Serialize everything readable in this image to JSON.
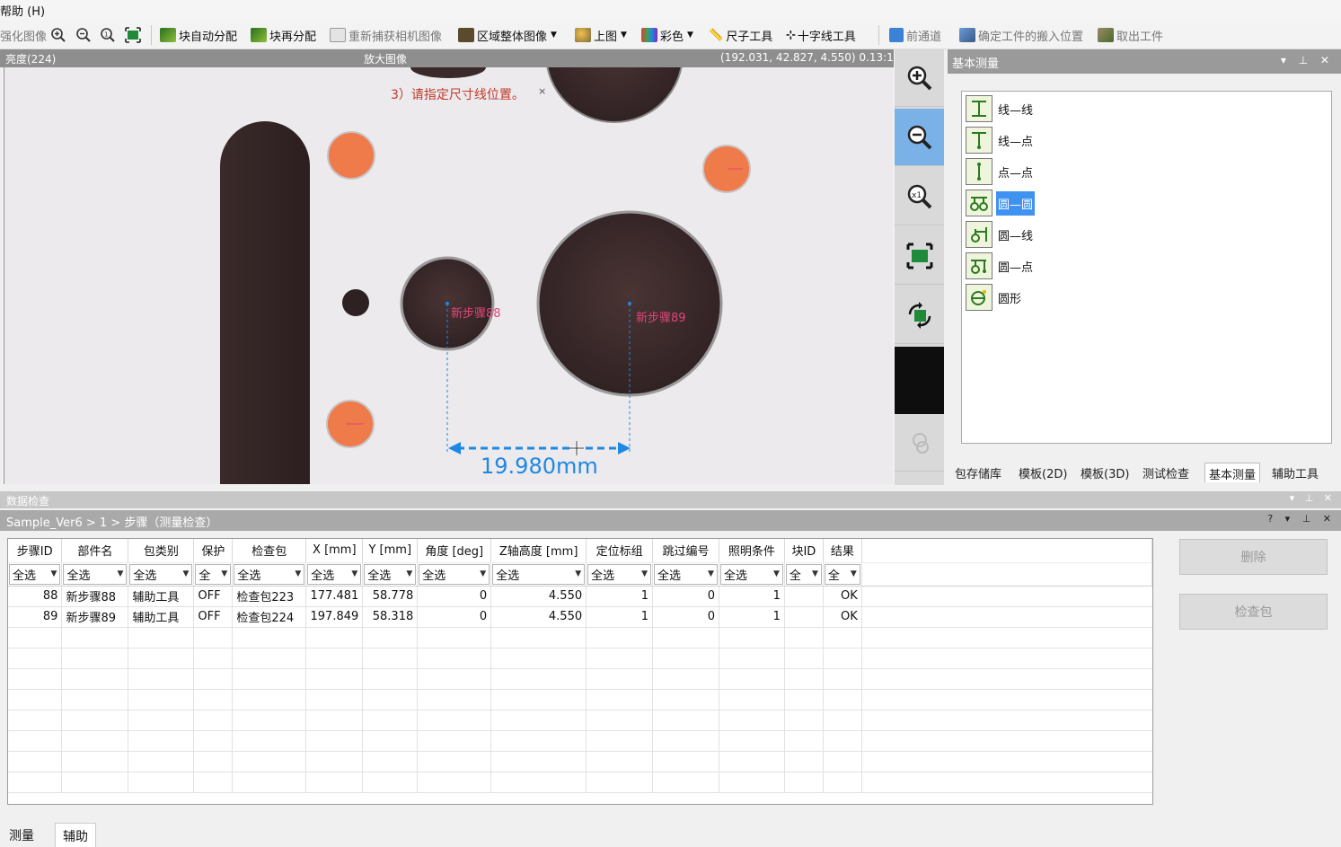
{
  "menu": {
    "help": "帮助 (H)"
  },
  "toolbar": {
    "items": [
      {
        "label": "强化图像",
        "dim": true
      },
      {
        "label": "块自动分配"
      },
      {
        "label": "块再分配"
      },
      {
        "label": "重新捕获相机图像",
        "dim": true
      },
      {
        "label": "区域整体图像"
      },
      {
        "label": "上图"
      },
      {
        "label": "彩色"
      },
      {
        "label": "尺子工具"
      },
      {
        "label": "十字线工具"
      },
      {
        "label": "前通道",
        "dim": true
      },
      {
        "label": "确定工件的搬入位置",
        "dim": true
      },
      {
        "label": "取出工件",
        "dim": true
      }
    ]
  },
  "image_view": {
    "brightness": "亮度(224)",
    "title": "放大图像",
    "coords": "(192.031, 42.827, 4.550) 0.13:1",
    "instruction": "3）请指定尺寸线位置。",
    "close_mark": "×",
    "step88_label": "新步骤88",
    "step89_label": "新步骤89",
    "dimension": "19.980mm"
  },
  "zoom": {
    "buttons": [
      "zoom-in",
      "zoom-out",
      "zoom-1x",
      "fit",
      "rotate"
    ]
  },
  "right_panel": {
    "title": "基本测量",
    "items": [
      "线—线",
      "线—点",
      "点—点",
      "圆—圆",
      "圆—线",
      "圆—点",
      "圆形"
    ],
    "selected_index": 3,
    "tabs": [
      "包存储库",
      "模板(2D)",
      "模板(3D)",
      "测试检查",
      "基本测量",
      "辅助工具"
    ],
    "active_tab": 4
  },
  "data_check": {
    "title": "数据检查",
    "breadcrumb": "Sample_Ver6 > 1 > 步骤（测量检查）",
    "help": "?",
    "columns": [
      "步骤ID",
      "部件名",
      "包类别",
      "保护",
      "检查包",
      "X [mm]",
      "Y [mm]",
      "角度 [deg]",
      "Z轴高度 [mm]",
      "定位标组",
      "跳过编号",
      "照明条件",
      "块ID",
      "结果"
    ],
    "filters": [
      "全选",
      "全选",
      "全选",
      "全",
      "全选",
      "全选",
      "全选",
      "全选",
      "全选",
      "全选",
      "全选",
      "全选",
      "全",
      "全"
    ],
    "rows": [
      [
        "88",
        "新步骤88",
        "辅助工具",
        "OFF",
        "检查包223",
        "177.481",
        "58.778",
        "0",
        "4.550",
        "1",
        "0",
        "1",
        "",
        "OK"
      ],
      [
        "89",
        "新步骤89",
        "辅助工具",
        "OFF",
        "检查包224",
        "197.849",
        "58.318",
        "0",
        "4.550",
        "1",
        "0",
        "1",
        "",
        "OK"
      ]
    ],
    "delete_btn": "删除",
    "pack_btn": "检查包"
  },
  "bottom_tabs": [
    "测量",
    "辅助"
  ],
  "colors": {
    "accent": "#3f92f0",
    "dim_arrow": "#1e88e5",
    "label_pink": "#e0457b",
    "instruction_red": "#c0392b"
  }
}
